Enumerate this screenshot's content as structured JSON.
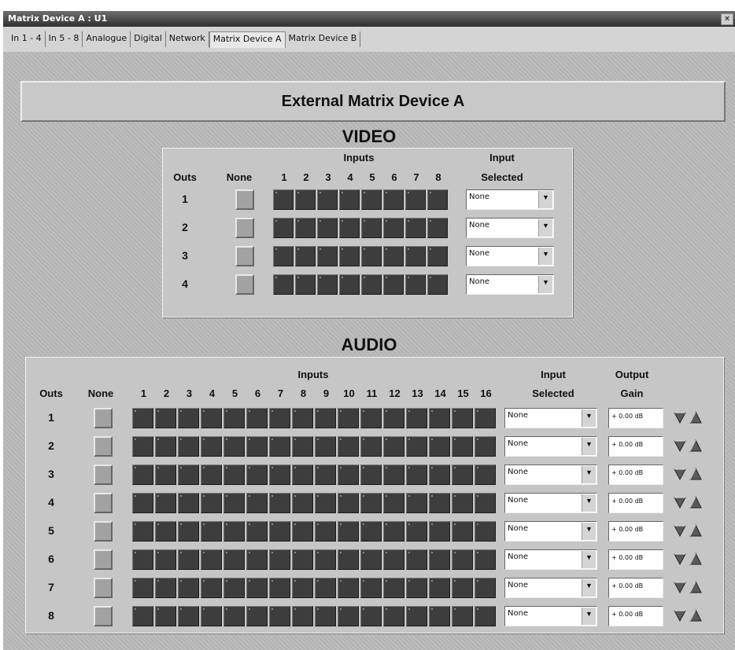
{
  "window": {
    "title": "Matrix Device A : U1",
    "close_icon": "close-icon"
  },
  "tabs": [
    "In 1 - 4",
    "In 5 - 8",
    "Analogue",
    "Digital",
    "Network",
    "Matrix Device A",
    "Matrix Device B"
  ],
  "active_tab": "Matrix Device A",
  "header": "External Matrix Device A",
  "video": {
    "title": "VIDEO",
    "outs_label": "Outs",
    "none_label": "None",
    "inputs_label": "Inputs",
    "input_selected_label": [
      "Input",
      "Selected"
    ],
    "input_numbers": [
      "1",
      "2",
      "3",
      "4",
      "5",
      "6",
      "7",
      "8"
    ],
    "outs": [
      "1",
      "2",
      "3",
      "4"
    ],
    "selected": [
      "None",
      "None",
      "None",
      "None"
    ]
  },
  "audio": {
    "title": "AUDIO",
    "outs_label": "Outs",
    "none_label": "None",
    "inputs_label": "Inputs",
    "input_selected_label": [
      "Input",
      "Selected"
    ],
    "output_gain_label": [
      "Output",
      "Gain"
    ],
    "input_numbers": [
      "1",
      "2",
      "3",
      "4",
      "5",
      "6",
      "7",
      "8",
      "9",
      "10",
      "11",
      "12",
      "13",
      "14",
      "15",
      "16"
    ],
    "outs": [
      "1",
      "2",
      "3",
      "4",
      "5",
      "6",
      "7",
      "8"
    ],
    "selected": [
      "None",
      "None",
      "None",
      "None",
      "None",
      "None",
      "None",
      "None"
    ],
    "gains": [
      "+ 0.00 dB",
      "+ 0.00 dB",
      "+ 0.00 dB",
      "+ 0.00 dB",
      "+ 0.00 dB",
      "+ 0.00 dB",
      "+ 0.00 dB",
      "+ 0.00 dB"
    ]
  },
  "icons": {
    "dropdown": "chevron-down-icon",
    "gain_down": "triangle-down-icon",
    "gain_up": "triangle-up-icon"
  }
}
